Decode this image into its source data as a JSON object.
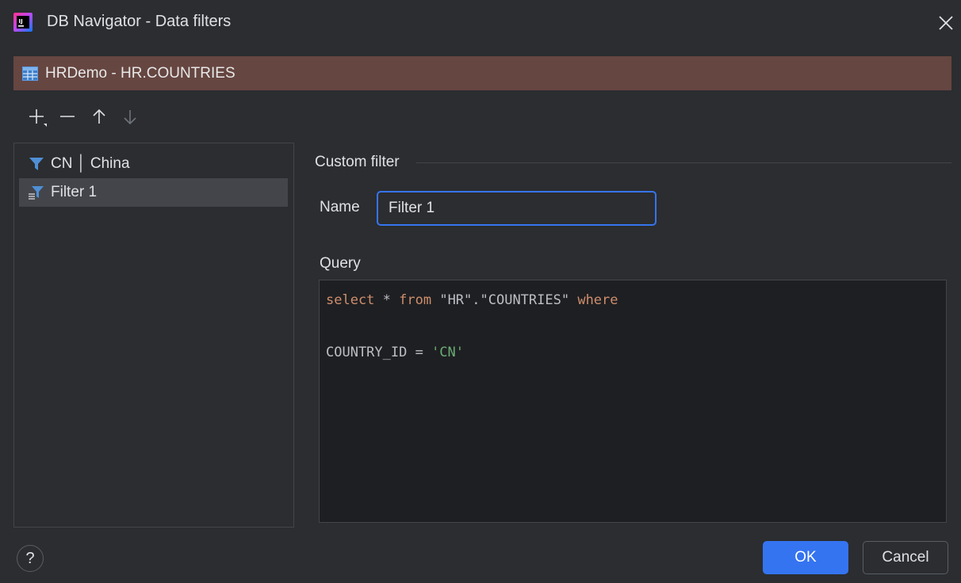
{
  "window": {
    "title": "DB Navigator - Data filters",
    "close_icon": "close-icon",
    "app_icon": "intellij-app-icon"
  },
  "header": {
    "icon": "table-icon",
    "text": "HRDemo - HR.COUNTRIES",
    "background": "#664641"
  },
  "toolbar": {
    "items": [
      {
        "name": "add-filter-button",
        "icon": "plus-icon"
      },
      {
        "name": "remove-filter-button",
        "icon": "minus-icon"
      },
      {
        "name": "move-up-button",
        "icon": "arrow-up-icon"
      },
      {
        "name": "move-down-button",
        "icon": "arrow-down-icon",
        "disabled": true
      }
    ]
  },
  "filters": {
    "items": [
      {
        "label": "CN │ China",
        "icon": "filter-icon",
        "selected": false
      },
      {
        "label": "Filter 1",
        "icon": "custom-filter-icon",
        "selected": true
      }
    ]
  },
  "custom_filter": {
    "section_title": "Custom filter",
    "name_label": "Name",
    "name_value": "Filter 1",
    "query_label": "Query",
    "query": {
      "kw_select": "select",
      "star": " * ",
      "kw_from": "from",
      "table": " \"HR\".\"COUNTRIES\" ",
      "kw_where": "where",
      "condition_col": "COUNTRY_ID = ",
      "condition_val": "'CN'"
    }
  },
  "footer": {
    "help_label": "?",
    "ok_label": "OK",
    "cancel_label": "Cancel"
  },
  "colors": {
    "accent": "#3574f0",
    "keyword": "#cf8e6d",
    "string": "#6aab73",
    "filter_icon": "#4f8fd6"
  }
}
